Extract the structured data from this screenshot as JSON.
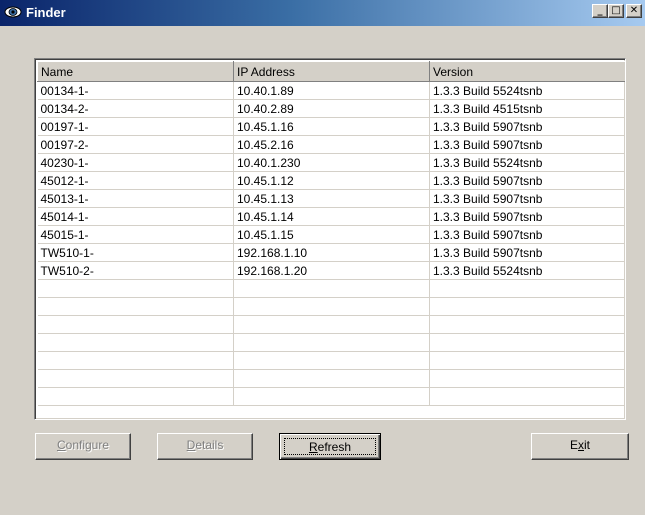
{
  "window": {
    "title": "Finder",
    "icon": "finder-eye-icon",
    "buttons": {
      "minimize": "_",
      "maximize": "□",
      "close": "✕"
    }
  },
  "table": {
    "columns": [
      "Name",
      "IP Address",
      "Version"
    ],
    "rows": [
      [
        "00134-1-",
        "10.40.1.89",
        "1.3.3 Build 5524tsnb"
      ],
      [
        "00134-2-",
        "10.40.2.89",
        "1.3.3 Build 4515tsnb"
      ],
      [
        "00197-1-",
        "10.45.1.16",
        "1.3.3 Build 5907tsnb"
      ],
      [
        "00197-2-",
        "10.45.2.16",
        "1.3.3 Build 5907tsnb"
      ],
      [
        "40230-1-",
        "10.40.1.230",
        "1.3.3 Build 5524tsnb"
      ],
      [
        "45012-1-",
        "10.45.1.12",
        "1.3.3 Build 5907tsnb"
      ],
      [
        "45013-1-",
        "10.45.1.13",
        "1.3.3 Build 5907tsnb"
      ],
      [
        "45014-1-",
        "10.45.1.14",
        "1.3.3 Build 5907tsnb"
      ],
      [
        "45015-1-",
        "10.45.1.15",
        "1.3.3 Build 5907tsnb"
      ],
      [
        "TW510-1-",
        "192.168.1.10",
        "1.3.3 Build 5907tsnb"
      ],
      [
        "TW510-2-",
        "192.168.1.20",
        "1.3.3 Build 5524tsnb"
      ]
    ]
  },
  "actions": {
    "configure": {
      "label_pre": "",
      "label_key": "C",
      "label_post": "onfigure",
      "enabled": false
    },
    "details": {
      "label_pre": "",
      "label_key": "D",
      "label_post": "etails",
      "enabled": false
    },
    "refresh": {
      "label_pre": "",
      "label_key": "R",
      "label_post": "efresh",
      "enabled": true
    },
    "exit": {
      "label_pre": "E",
      "label_key": "x",
      "label_post": "it",
      "enabled": true
    }
  }
}
